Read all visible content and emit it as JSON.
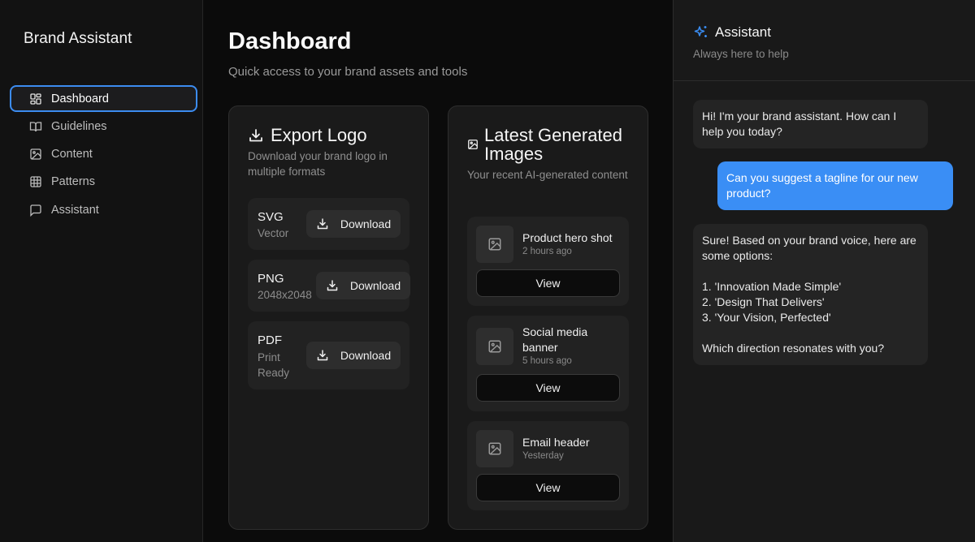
{
  "app": {
    "brand": "Brand Assistant"
  },
  "sidebar": {
    "items": [
      {
        "label": "Dashboard",
        "icon": "dashboard-grid-icon",
        "active": true
      },
      {
        "label": "Guidelines",
        "icon": "book-icon",
        "active": false
      },
      {
        "label": "Content",
        "icon": "image-icon",
        "active": false
      },
      {
        "label": "Patterns",
        "icon": "grid-table-icon",
        "active": false
      },
      {
        "label": "Assistant",
        "icon": "chat-bubble-icon",
        "active": false
      }
    ]
  },
  "main": {
    "title": "Dashboard",
    "subtitle": "Quick access to your brand assets and tools",
    "export": {
      "title": "Export Logo",
      "description": "Download your brand logo in multiple formats",
      "formats": [
        {
          "name": "SVG",
          "detail": "Vector",
          "button": "Download"
        },
        {
          "name": "PNG",
          "detail": "2048x2048",
          "button": "Download"
        },
        {
          "name": "PDF",
          "detail": "Print\nReady",
          "button": "Download"
        }
      ]
    },
    "latest": {
      "title": "Latest Generated Images",
      "description": "Your recent AI-generated content",
      "items": [
        {
          "name": "Product hero shot",
          "time": "2 hours ago",
          "button": "View"
        },
        {
          "name": "Social media banner",
          "time": "5 hours ago",
          "button": "View"
        },
        {
          "name": "Email header",
          "time": "Yesterday",
          "button": "View"
        }
      ]
    }
  },
  "assistant": {
    "title": "Assistant",
    "subtitle": "Always here to help",
    "messages": [
      {
        "role": "bot",
        "text": "Hi! I'm your brand assistant. How can I help you today?"
      },
      {
        "role": "user",
        "text": "Can you suggest a tagline for our new product?"
      },
      {
        "role": "bot",
        "text": "Sure! Based on your brand voice, here are some options:\n\n1. 'Innovation Made Simple'\n2. 'Design That Delivers'\n3. 'Your Vision, Perfected'\n\nWhich direction resonates with you?"
      }
    ]
  },
  "colors": {
    "accent": "#3a8ef5",
    "background": "#0b0b0b",
    "card": "#1a1a1a"
  }
}
